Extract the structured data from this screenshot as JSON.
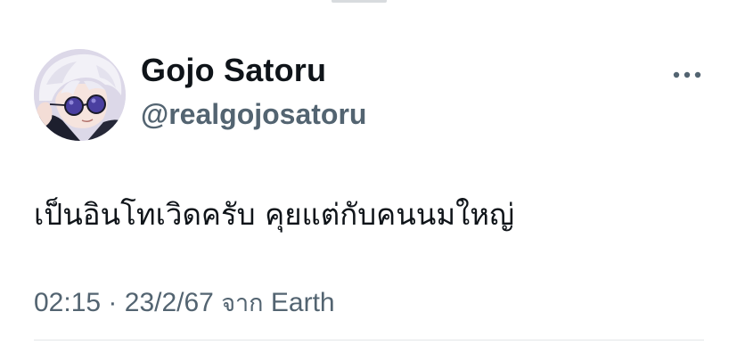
{
  "tweet": {
    "author": {
      "display_name": "Gojo Satoru",
      "handle": "@realgojosatoru",
      "avatar_icon": "avatar-anime-character"
    },
    "more_icon": "more-horizontal-icon",
    "text": "เป็นอินโทเวิดครับ คุยแต่กับคนนมใหญ่",
    "time": "02:15",
    "separator": "·",
    "date": "23/2/67",
    "source_prefix": "จาก",
    "source": "Earth"
  },
  "colors": {
    "primary_text": "#0f1419",
    "secondary_text": "#536471",
    "divider": "#e3e6e8",
    "background": "#ffffff"
  }
}
